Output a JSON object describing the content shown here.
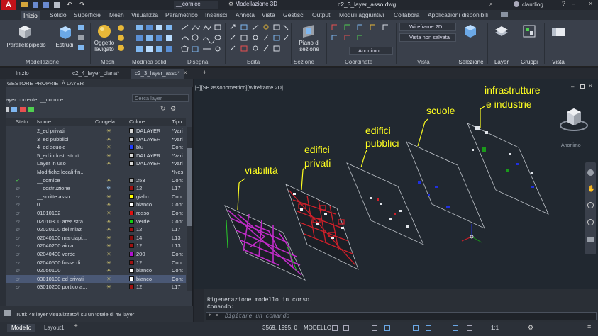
{
  "titlebar": {
    "app_letter": "A",
    "workspace": "Modellazione 3D",
    "layer_dropdown": "__cornice",
    "file_title": "c2_3_layer_asso.dwg",
    "user": "claudiog"
  },
  "ribbon_tabs": [
    "Inizio",
    "Solido",
    "Superficie",
    "Mesh",
    "Visualizza",
    "Parametrico",
    "Inserisci",
    "Annota",
    "Vista",
    "Gestisci",
    "Output",
    "Moduli aggiuntivi",
    "Collabora",
    "Applicazioni disponibili"
  ],
  "ribbon": {
    "modellazione": {
      "title": "Modellazione",
      "parallelepipedo": "Parallelepipedo",
      "estrudi": "Estrudi"
    },
    "mesh": {
      "title": "Mesh",
      "oggetto_levigato_1": "Oggetto",
      "oggetto_levigato_2": "levigato"
    },
    "modifica_solidi": {
      "title": "Modifica solidi"
    },
    "disegna": {
      "title": "Disegna"
    },
    "edita": {
      "title": "Edita"
    },
    "sezione": {
      "title": "Sezione",
      "piano_1": "Piano di",
      "piano_2": "sezione"
    },
    "coordinate": {
      "title": "Coordinate"
    },
    "vista": {
      "title": "Vista",
      "visual_style": "Wireframe 2D",
      "saved_view": "Vista non salvata",
      "anonimo": "Anonimo"
    },
    "selezione": "Selezione",
    "layer": "Layer",
    "gruppi": "Gruppi",
    "vista_big": "Vista"
  },
  "doc_tabs": [
    "Inizio",
    "c2_4_layer_piana*",
    "c2_3_layer_asso*"
  ],
  "layer_panel": {
    "title": "GESTORE PROPRIETÀ LAYER",
    "current_layer": "Layer corrente: __cornice",
    "search_placeholder": "Cerca layer",
    "columns": [
      "Stato",
      "Nome",
      "Congela",
      "Colore",
      "Tipo"
    ],
    "rows": [
      {
        "name": "2_ed privati",
        "color": "DALAYER",
        "swatch": "#d8d8d8",
        "type": "*Vari"
      },
      {
        "name": "3_ed pubblici",
        "color": "DALAYER",
        "swatch": "#d8d8d8",
        "type": "*Vari"
      },
      {
        "name": "4_ed scuole",
        "color": "blu",
        "swatch": "#1f3cff",
        "type": "Cont"
      },
      {
        "name": "5_ed industr strutt",
        "color": "DALAYER",
        "swatch": "#d8d8d8",
        "type": "*Vari"
      },
      {
        "name": "Layer in uso",
        "color": "DALAYER",
        "swatch": "#d8d8d8",
        "type": "*Vari"
      },
      {
        "name": "Modifiche locali fin...",
        "color": "",
        "swatch": "",
        "type": "*Nes"
      },
      {
        "name": "__cornice",
        "color": "253",
        "swatch": "#b0b0b0",
        "type": "Cont"
      },
      {
        "name": "__costruzione",
        "color": "12",
        "swatch": "#a01010",
        "type": "L17"
      },
      {
        "name": "__scritte asso",
        "color": "giallo",
        "swatch": "#ffff00",
        "type": "Cont"
      },
      {
        "name": "0",
        "color": "bianco",
        "swatch": "#ffffff",
        "type": "Cont"
      },
      {
        "name": "01010102",
        "color": "rosso",
        "swatch": "#e01010",
        "type": "Cont"
      },
      {
        "name": "02010300 area stra...",
        "color": "verde",
        "swatch": "#10d010",
        "type": "Cont"
      },
      {
        "name": "02020100 delimiaz",
        "color": "12",
        "swatch": "#a01010",
        "type": "L17"
      },
      {
        "name": "02040100 marciapi...",
        "color": "14",
        "swatch": "#8a0a0a",
        "type": "L13"
      },
      {
        "name": "02040200 aiola",
        "color": "12",
        "swatch": "#a01010",
        "type": "L13"
      },
      {
        "name": "02040400 verde",
        "color": "200",
        "swatch": "#b010d0",
        "type": "Cont"
      },
      {
        "name": "02040500 fosse di...",
        "color": "12",
        "swatch": "#a01010",
        "type": "Cont"
      },
      {
        "name": "02050100",
        "color": "bianco",
        "swatch": "#ffffff",
        "type": "Cont"
      },
      {
        "name": "03010100 ed privati",
        "color": "bianco",
        "swatch": "#ffffff",
        "type": "Cont"
      },
      {
        "name": "03010200 portico a...",
        "color": "12",
        "swatch": "#a01010",
        "type": "L17"
      }
    ],
    "footer": "Tutti: 48 layer visualizzato/i su un totale di 48 layer",
    "side_label": "GESTORE PROPRIETÀ LAYER"
  },
  "viewport": {
    "header": "[−][SE assonometrico][Wireframe 2D]",
    "nav_label": "Anonimo",
    "labels": [
      "viabilità",
      "edifici",
      "privati",
      "edifici",
      "pubblici",
      "scuole",
      "infrastrutture",
      "e industrie"
    ]
  },
  "command": {
    "line1": "Rigenerazione modello in corso.",
    "line2": "Comando:",
    "placeholder": "Digitare un comando"
  },
  "status": {
    "tabs": [
      "Modello",
      "Layout1"
    ],
    "coords": "3569, 1995, 0",
    "mode": "MODELLO",
    "scale": "1:1"
  }
}
